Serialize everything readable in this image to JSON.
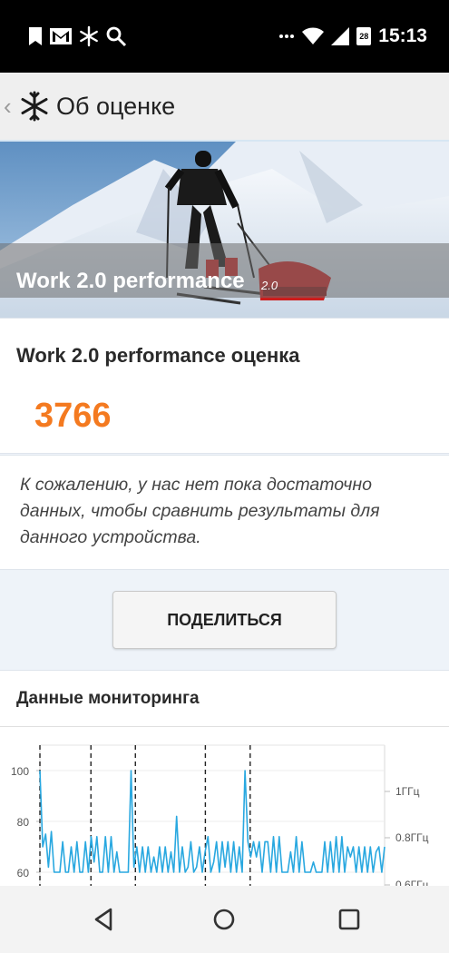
{
  "status_bar": {
    "time": "15:13",
    "calendar_day": "28",
    "left_icons": [
      "bookmark-icon",
      "gmail-icon",
      "snowflake-icon",
      "search-icon"
    ],
    "right_icons": [
      "more-dots-icon",
      "wifi-icon",
      "signal-icon",
      "calendar-icon"
    ]
  },
  "app_bar": {
    "back_glyph": "‹",
    "title": "Об оценке"
  },
  "hero": {
    "title": "Work 2.0 performance",
    "version": "2.0"
  },
  "score": {
    "label": "Work 2.0 performance оценка",
    "value": "3766",
    "value_color": "#f47a20"
  },
  "message": {
    "text": "К сожалению, у нас нет пока достаточно данных, чтобы сравнить результаты для данного устройства."
  },
  "share_button": {
    "label": "ПОДЕЛИТЬСЯ"
  },
  "monitoring": {
    "title": "Данные мониторинга"
  },
  "chart_data": {
    "type": "line",
    "y_left_ticks": [
      "100",
      "80",
      "60"
    ],
    "y_right_ticks": [
      "1ГГц",
      "0.8ГГц",
      "0.6ГГц"
    ],
    "ylim": [
      55,
      110
    ],
    "series": [
      {
        "color": "#29a8e0",
        "values": [
          100,
          70,
          75,
          62,
          76,
          60,
          60,
          60,
          72,
          60,
          60,
          70,
          60,
          72,
          60,
          60,
          72,
          60,
          74,
          64,
          74,
          60,
          60,
          74,
          60,
          74,
          60,
          68,
          60,
          60,
          60,
          60,
          100,
          62,
          70,
          60,
          70,
          60,
          70,
          60,
          66,
          60,
          70,
          60,
          70,
          60,
          68,
          60,
          82,
          60,
          70,
          60,
          62,
          72,
          60,
          62,
          70,
          60,
          68,
          74,
          60,
          64,
          72,
          60,
          72,
          62,
          72,
          60,
          72,
          60,
          70,
          60,
          100,
          72,
          66,
          72,
          66,
          72,
          60,
          72,
          72,
          60,
          74,
          60,
          74,
          60,
          60,
          60,
          68,
          60,
          74,
          60,
          72,
          60,
          60,
          60,
          64,
          60,
          60,
          60,
          72,
          60,
          72,
          60,
          74,
          60,
          74,
          60,
          70,
          66,
          70,
          60,
          70,
          60,
          70,
          60,
          70,
          60,
          68,
          70,
          60,
          70
        ]
      }
    ],
    "markers": [
      0.0,
      0.148,
      0.277,
      0.48,
      0.61
    ],
    "grid": true
  },
  "nav_bar": {
    "buttons": [
      "back-nav-icon",
      "home-nav-icon",
      "recents-nav-icon"
    ]
  }
}
